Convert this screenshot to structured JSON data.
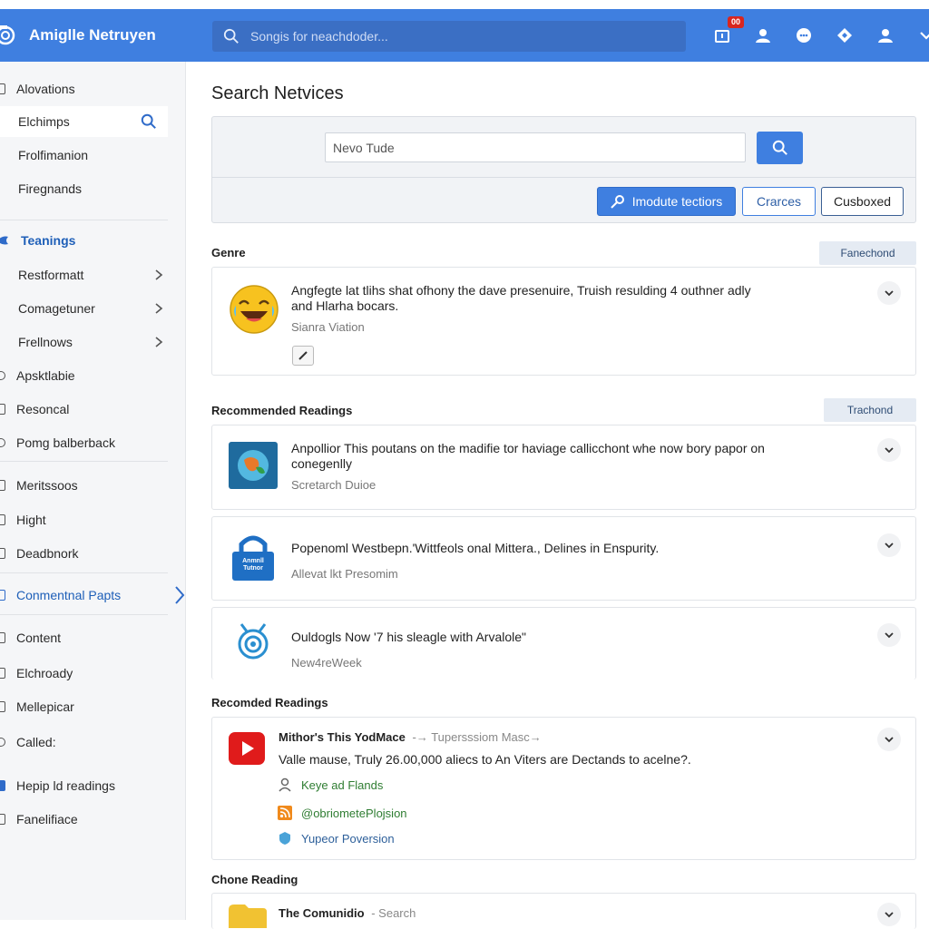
{
  "topbar": {
    "brand": "Amiglle Netruyen",
    "search_placeholder": "Songis for neachdoder...",
    "notif_badge": "00"
  },
  "sidebar": {
    "items": [
      {
        "label": "Alovations"
      },
      {
        "label": "Elchimps"
      },
      {
        "label": "Frolfimanion"
      },
      {
        "label": "Firegnands"
      },
      {
        "label": "Teanings"
      },
      {
        "label": "Restformatt"
      },
      {
        "label": "Comagetuner"
      },
      {
        "label": "Frellnows"
      },
      {
        "label": "Apsktlabie"
      },
      {
        "label": "Resoncal"
      },
      {
        "label": "Pomg balberback"
      },
      {
        "label": "Meritssoos"
      },
      {
        "label": "Hight"
      },
      {
        "label": "Deadbnork"
      },
      {
        "label": "Conmentnal Papts"
      },
      {
        "label": "Content"
      },
      {
        "label": "Elchroady"
      },
      {
        "label": "Mellepicar"
      },
      {
        "label": "Called:"
      },
      {
        "label": "Hepip ld readings"
      },
      {
        "label": "Fanelifiace"
      }
    ]
  },
  "main": {
    "title": "Search Netvices",
    "search_input_value": "Nevo Tude",
    "btn_primary": "Imodute tectiors",
    "btn_outline_1": "Crarces",
    "btn_outline_2": "Cusboxed",
    "sections": {
      "genre": {
        "label": "Genre",
        "tag": "Fanechond",
        "card": {
          "title_line1": "Angfegte lat tlihs  shat ofhony the dave presenuire, Truish resulding 4 outhner adly",
          "title_line2": "and Hlarha bocars.",
          "sub": "Sianra Viation"
        }
      },
      "recommended": {
        "label": "Recommended Readings",
        "tag": "Trachond",
        "cards": [
          {
            "title_line1": "Anpollior This poutans on the madifie tor haviage callicchont whe now bory papor on",
            "title_line2": "conegenlly",
            "sub": "Scretarch Duioe"
          },
          {
            "title_line1": "Popenoml Westbepn.'Wittfeols onal Mittera., Delines in Enspurity.",
            "sub": "Allevat lkt Presomim",
            "thumb_text": "Anmnll Tutnor"
          },
          {
            "title_line1": "Ouldogls Now '7 his sleagle with Arvalole\"",
            "sub": "New4reWeek"
          }
        ]
      },
      "recomded": {
        "label": "Recomded Readings",
        "card": {
          "title_bold": "Mithor's This YodMace",
          "title_extra": "-→ Tupersssiom Masc→",
          "line2": "Valle mause, Truly 26.00,000 aliecs to An Viters are Dectands to acelne?.",
          "links": [
            "Keye ad Flands",
            "@obriometePlojsion",
            "Yupeor Poversion"
          ]
        }
      },
      "chone": {
        "label": "Chone Reading",
        "card_title": "The Comunidio",
        "card_extra": "-  Search"
      }
    }
  },
  "colors": {
    "accent": "#3f7fe0",
    "link_green": "#2f7d32",
    "badge_red": "#d8261f"
  }
}
